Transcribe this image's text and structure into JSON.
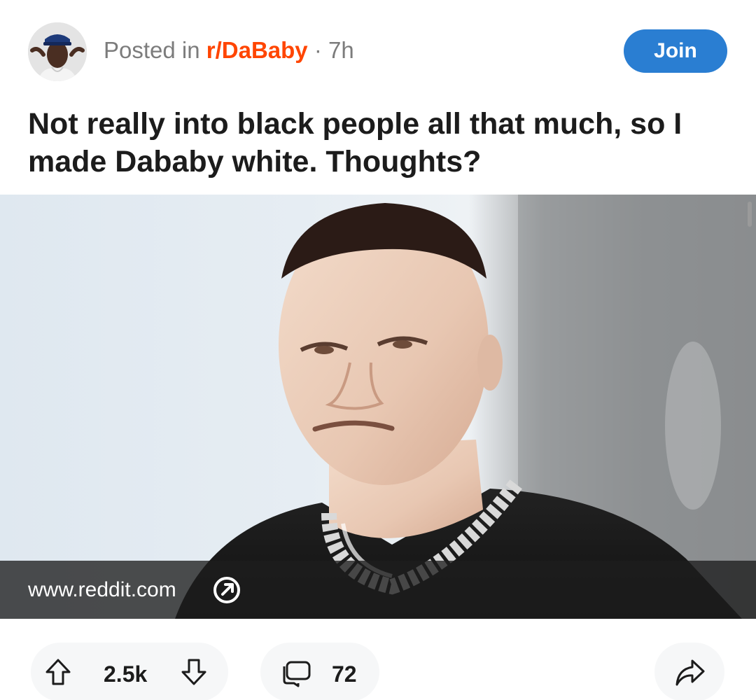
{
  "post": {
    "posted_in_prefix": "Posted in ",
    "subreddit": "r/DaBaby",
    "time": " · 7h",
    "join_label": "Join",
    "title": "Not really into black people all that much, so I made Dababy white. Thoughts?"
  },
  "link": {
    "domain": "www.reddit.com"
  },
  "actions": {
    "score": "2.5k",
    "comments": "72"
  },
  "icons": {
    "upvote": "upvote-arrow-icon",
    "downvote": "downvote-arrow-icon",
    "comment": "comment-bubble-icon",
    "share": "share-arrow-icon",
    "external": "external-link-icon"
  },
  "colors": {
    "join_button": "#2a7ed2",
    "subreddit": "#ff4500",
    "meta_text": "#7c7c7c"
  }
}
